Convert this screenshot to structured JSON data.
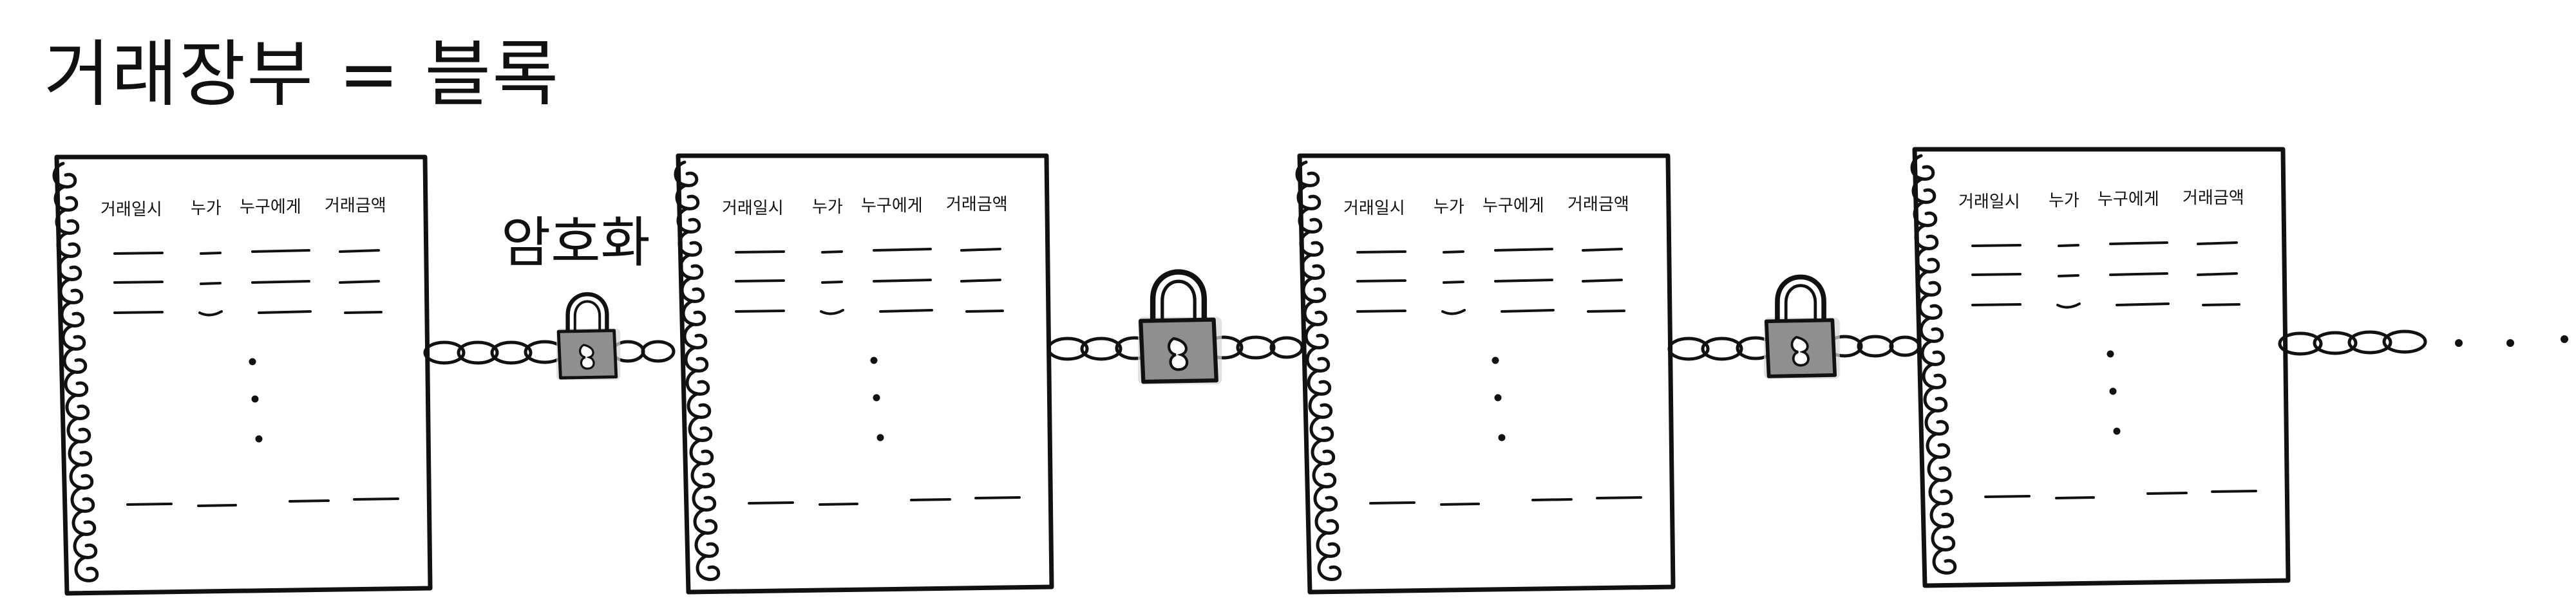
{
  "title": "거래장부 = 블록",
  "encryption_label": "암호화",
  "ledger": {
    "columns": [
      "거래일시",
      "누가",
      "누구에게",
      "거래금액"
    ]
  },
  "block_count": 4,
  "colors": {
    "ink": "#111111",
    "lock_body": "#8f8f8f",
    "lock_shadow": "#c8c8c8",
    "paper": "#ffffff"
  },
  "icons": [
    "padlock-icon",
    "chain-link-icon",
    "spiral-binding-icon",
    "ellipsis-dots-icon"
  ]
}
